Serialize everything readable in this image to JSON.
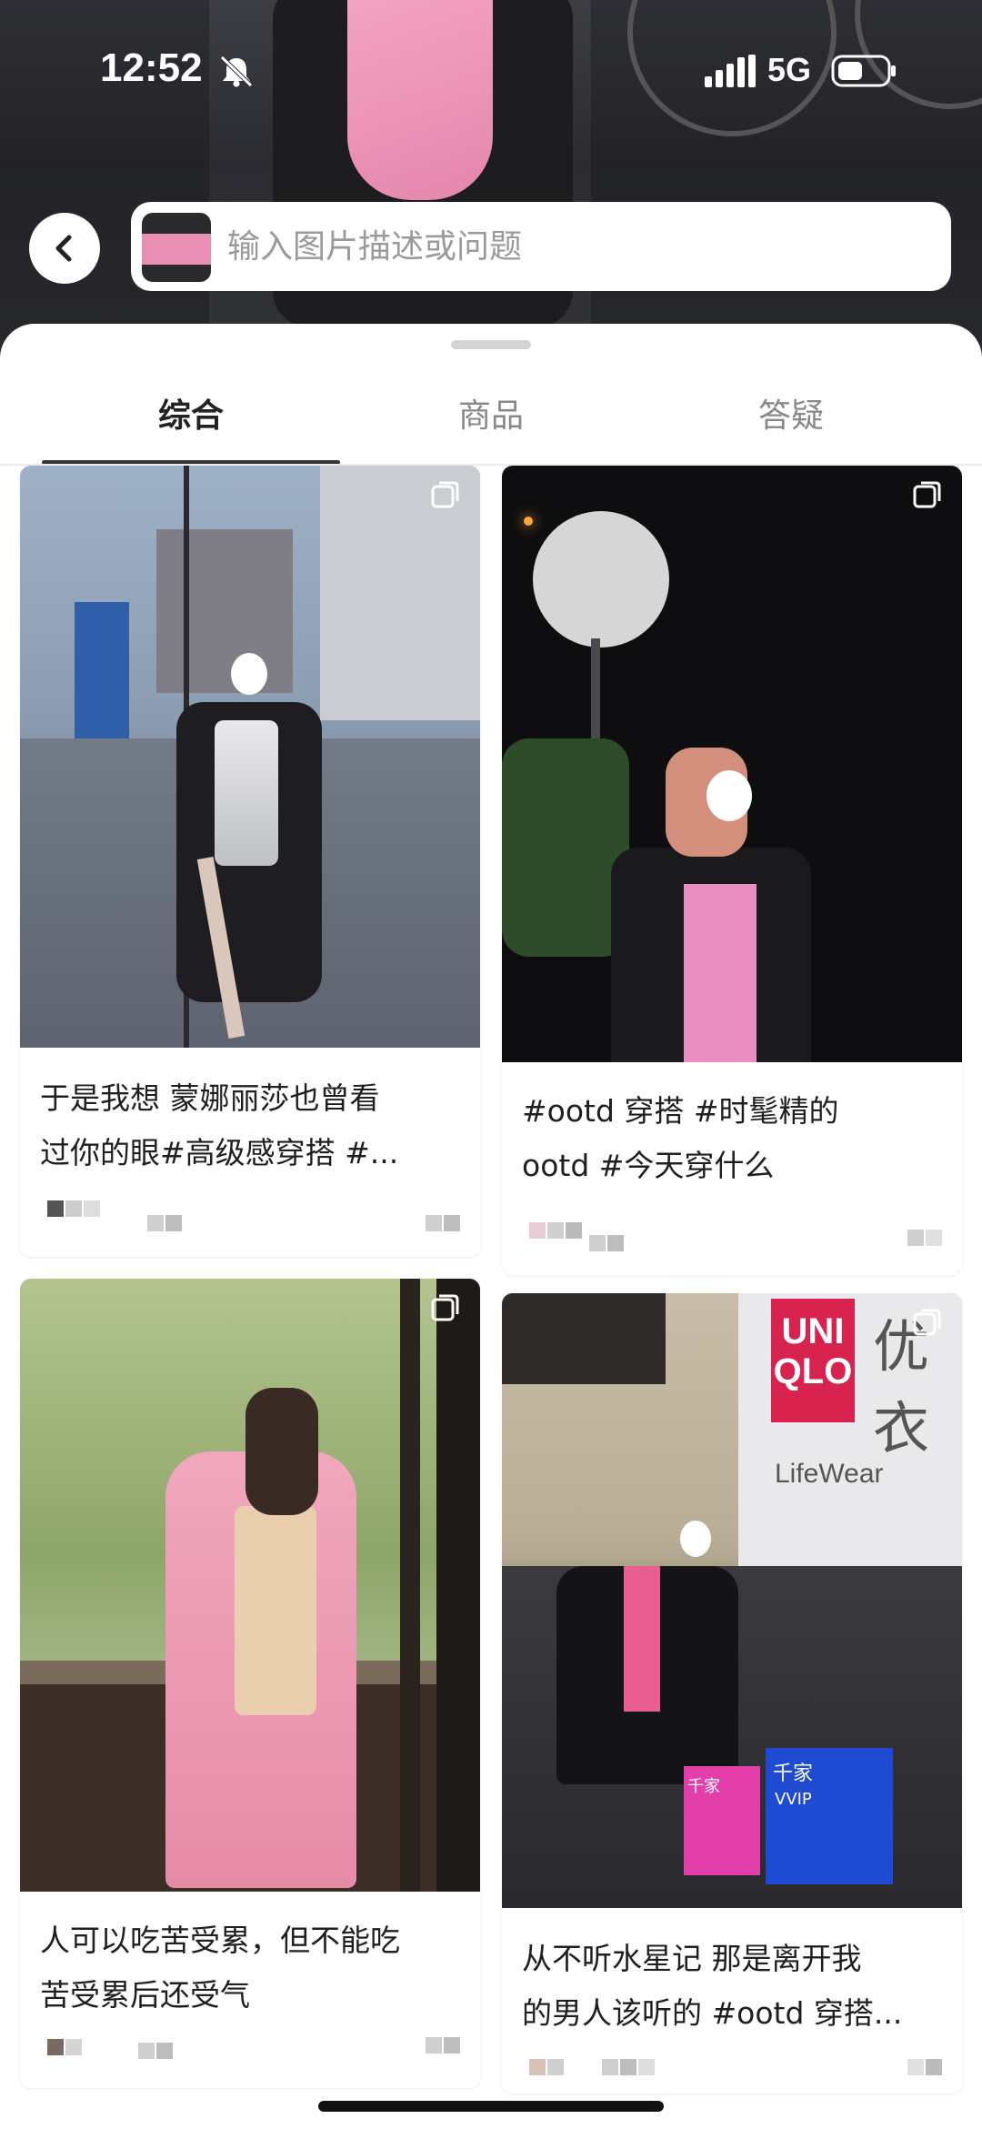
{
  "status_bar": {
    "time": "12:52",
    "network": "5G",
    "icons": [
      "bell-muted-icon",
      "signal-icon",
      "battery-icon"
    ]
  },
  "search": {
    "placeholder": "输入图片描述或问题",
    "back_icon": "chevron-left-icon"
  },
  "tabs": [
    {
      "label": "综合",
      "active": true
    },
    {
      "label": "商品",
      "active": false
    },
    {
      "label": "答疑",
      "active": false
    }
  ],
  "feed": [
    {
      "caption": "于是我想 蒙娜丽莎也曾看\n过你的眼#高级感穿搭 #...",
      "icon": "multi-image-icon"
    },
    {
      "caption": "#ootd 穿搭 #时髦精的\nootd #今天穿什么",
      "icon": "multi-image-icon"
    },
    {
      "caption": "人可以吃苦受累，但不能吃\n苦受累后还受气",
      "icon": "multi-image-icon"
    },
    {
      "caption": "从不听水星记 那是离开我\n的男人该听的 #ootd 穿搭...",
      "icon": "multi-image-icon"
    }
  ],
  "image_signage": {
    "store_logo": "UNI QLO",
    "store_sign_partial": "优衣",
    "lifewear": "LifeWear",
    "bag_text": "千家",
    "bag_text_2": "千家",
    "bag_vip": "VVIP"
  },
  "colors": {
    "active_tab": "#222222",
    "inactive_tab": "#888888",
    "sheet_bg": "#ffffff",
    "page_bg": "#f1f1f1"
  }
}
